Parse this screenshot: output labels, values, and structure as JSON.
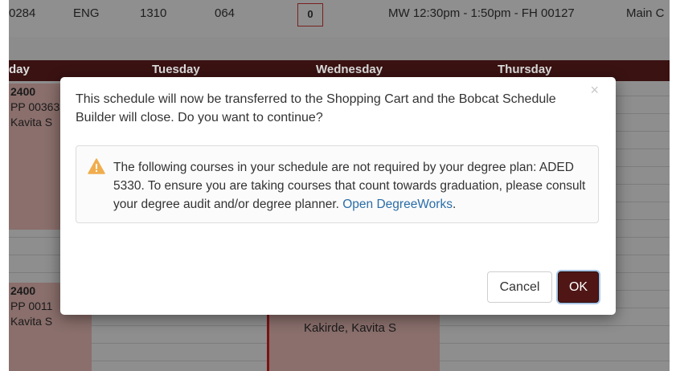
{
  "course_row": {
    "crn": "0284",
    "subject": "ENG",
    "course_number": "1310",
    "section": "064",
    "seats": "0",
    "meeting": "MW 12:30pm - 1:50pm - FH 00127",
    "campus": "Main C"
  },
  "calendar": {
    "days": [
      "day",
      "Tuesday",
      "Wednesday",
      "Thursday"
    ],
    "events": [
      {
        "time": "2400",
        "room": "PP 00363",
        "instructor": "Kavita S"
      },
      {
        "time": "2400",
        "room": "PP 0011",
        "instructor": "Kavita S"
      }
    ],
    "wednesday_event": {
      "instructor": "Kakirde, Kavita S"
    }
  },
  "modal": {
    "message": "This schedule will now be transferred to the Shopping Cart and the Bobcat Schedule Builder will close. Do you want to continue?",
    "close_symbol": "×",
    "warning": {
      "text": "The following courses in your schedule are not required by your degree plan: ADED 5330. To ensure you are taking courses that count towards graduation, please consult your degree audit and/or degree planner.",
      "link_label": "Open DegreeWorks",
      "after_link": "."
    },
    "cancel_label": "Cancel",
    "ok_label": "OK"
  },
  "colors": {
    "accent": "#501616",
    "link": "#2a6da8",
    "warning": "#f0ad4e"
  }
}
